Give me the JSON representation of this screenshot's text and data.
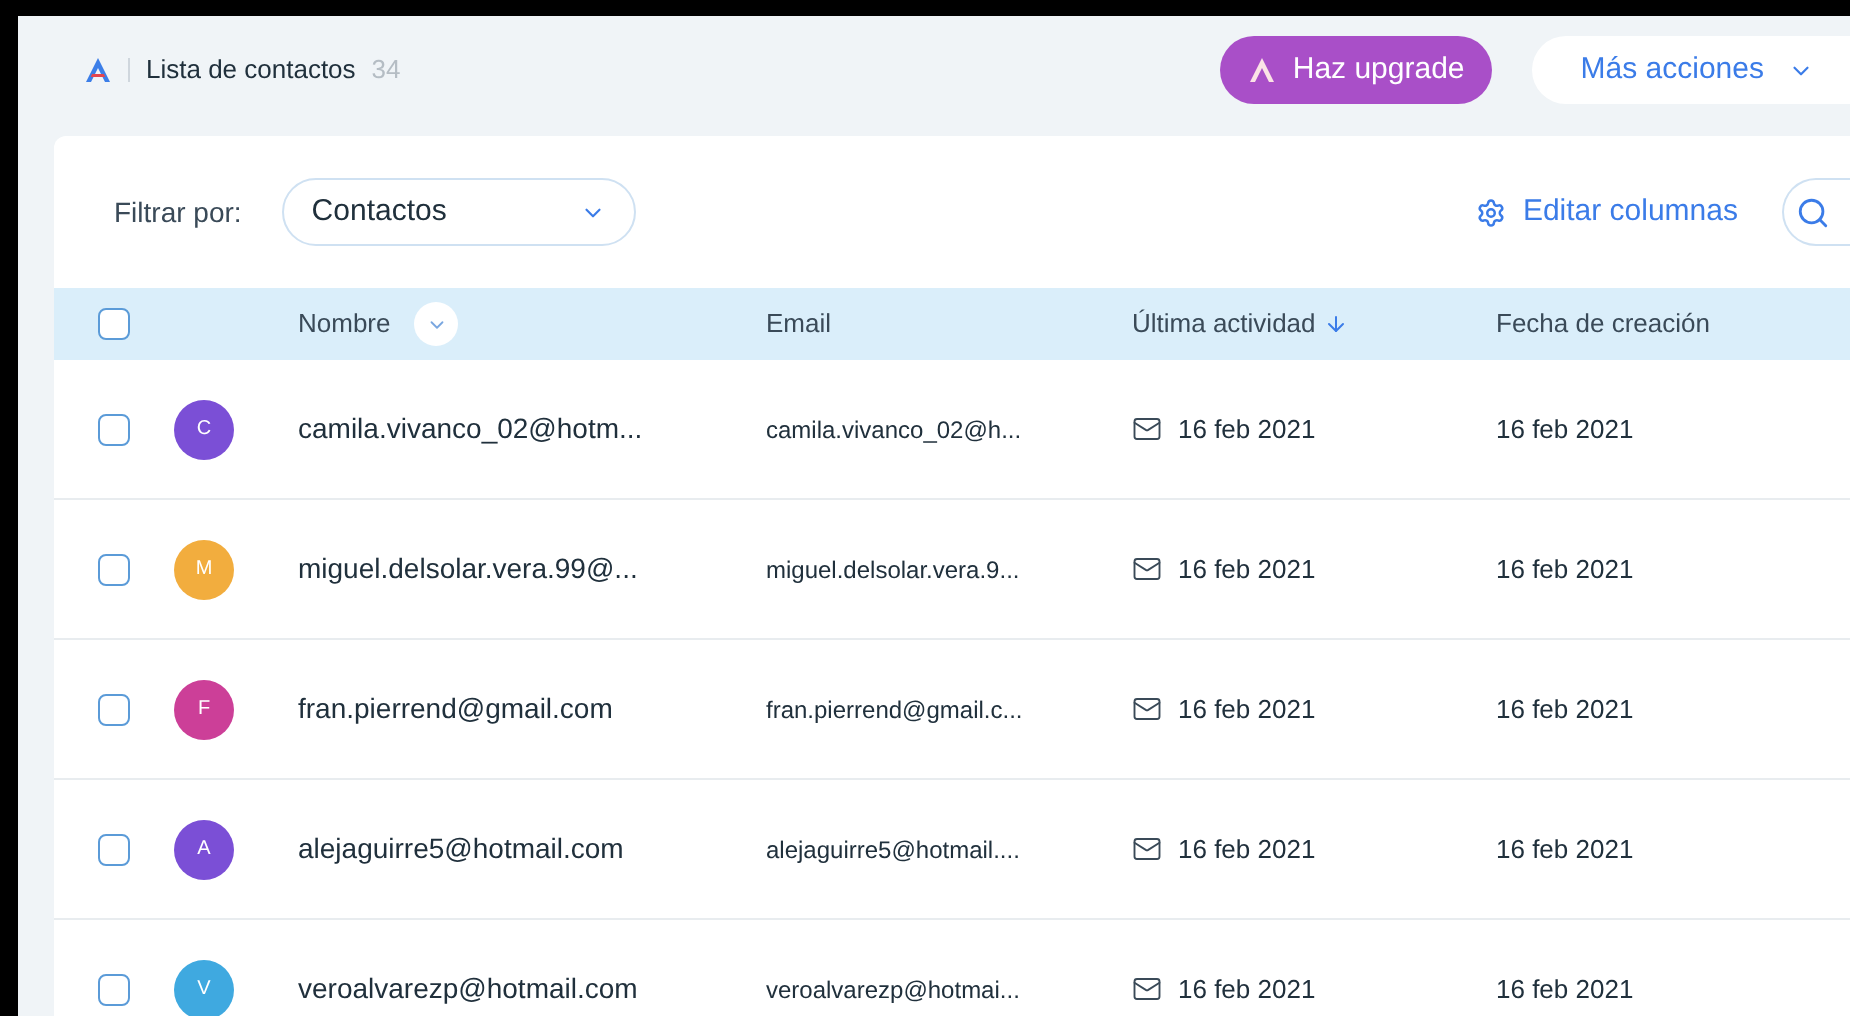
{
  "header": {
    "title": "Lista de contactos",
    "count": "34",
    "upgrade_button": "Haz upgrade",
    "more_button": "Más acciones"
  },
  "filter": {
    "label": "Filtrar por:",
    "value": "Contactos",
    "edit_columns": "Editar columnas"
  },
  "table": {
    "select_all_checked": false,
    "columns": [
      {
        "label": "Nombre",
        "kind": "menu"
      },
      {
        "label": "Email",
        "kind": "plain"
      },
      {
        "label": "Última actividad",
        "kind": "sorted"
      },
      {
        "label": "Fecha de creación",
        "kind": "plain"
      }
    ],
    "rows": [
      {
        "initial": "C",
        "color": "#7b4fd6",
        "name": "camila.vivanco_02@hotm...",
        "email": "camila.vivanco_02@h...",
        "activity": "16 feb 2021",
        "created": "16 feb 2021",
        "checked": false
      },
      {
        "initial": "M",
        "color": "#f2ad3e",
        "name": "miguel.delsolar.vera.99@...",
        "email": "miguel.delsolar.vera.9...",
        "activity": "16 feb 2021",
        "created": "16 feb 2021",
        "checked": false
      },
      {
        "initial": "F",
        "color": "#cc3f98",
        "name": "fran.pierrend@gmail.com",
        "email": "fran.pierrend@gmail.c...",
        "activity": "16 feb 2021",
        "created": "16 feb 2021",
        "checked": false
      },
      {
        "initial": "A",
        "color": "#7b4fd6",
        "name": "alejaguirre5@hotmail.com",
        "email": "alejaguirre5@hotmail....",
        "activity": "16 feb 2021",
        "created": "16 feb 2021",
        "checked": false
      },
      {
        "initial": "V",
        "color": "#3fa9e0",
        "name": "veroalvarezp@hotmail.com",
        "email": "veroalvarezp@hotmai...",
        "activity": "16 feb 2021",
        "created": "16 feb 2021",
        "checked": false
      }
    ]
  }
}
